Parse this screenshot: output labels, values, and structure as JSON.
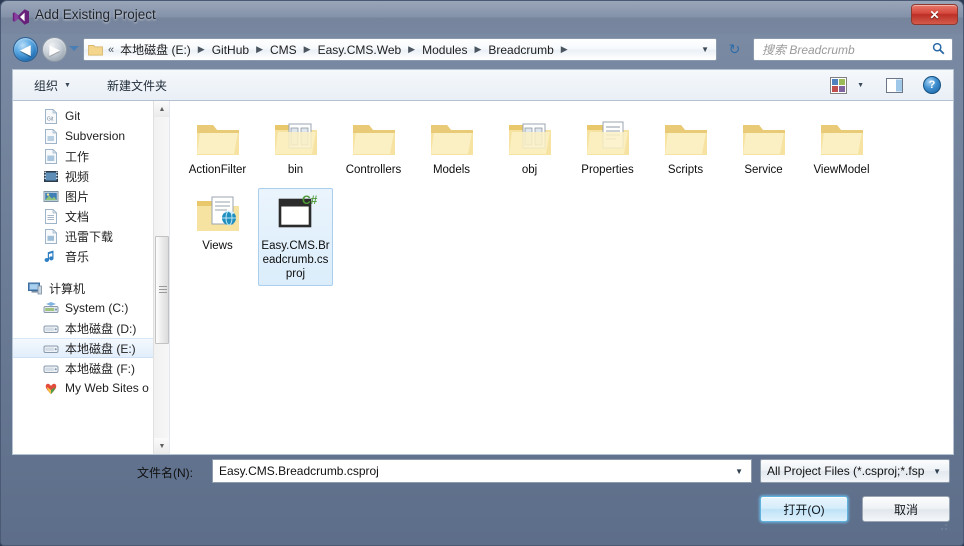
{
  "window": {
    "title": "Add Existing Project",
    "app_icon": "visual-studio-icon",
    "close_label": "✕",
    "accent_blue": "#2e6ca8",
    "close_red": "#d4453a"
  },
  "nav": {
    "back_label": "◀",
    "forward_label": "▶",
    "recent_label": "▾",
    "refresh_label": "↻",
    "breadcrumb_overflow": "«",
    "breadcrumb": [
      "本地磁盘 (E:)",
      "GitHub",
      "CMS",
      "Easy.CMS.Web",
      "Modules",
      "Breadcrumb"
    ],
    "breadcrumb_separator": "▶",
    "addr_dropdown_label": "▼"
  },
  "search": {
    "placeholder": "搜索 Breadcrumb",
    "icon": "search-icon",
    "icon_glyph": "🔍"
  },
  "toolbar": {
    "organize_label": "组织",
    "organize_caret": "▼",
    "new_folder_label": "新建文件夹",
    "viewmode_caret": "▼",
    "help_label": "?"
  },
  "sidebar": {
    "items": [
      {
        "label": "Git",
        "icon": "git-folder-icon",
        "type": "item",
        "selected": false
      },
      {
        "label": "Subversion",
        "icon": "subversion-folder-icon",
        "type": "item",
        "selected": false
      },
      {
        "label": "工作",
        "icon": "work-folder-icon",
        "type": "item",
        "selected": false
      },
      {
        "label": "视频",
        "icon": "videos-icon",
        "type": "item",
        "selected": false
      },
      {
        "label": "图片",
        "icon": "pictures-icon",
        "type": "item",
        "selected": false
      },
      {
        "label": "文档",
        "icon": "documents-icon",
        "type": "item",
        "selected": false
      },
      {
        "label": "迅雷下载",
        "icon": "downloads-icon",
        "type": "item",
        "selected": false
      },
      {
        "label": "音乐",
        "icon": "music-icon",
        "type": "item",
        "selected": false
      },
      {
        "label": "计算机",
        "icon": "computer-icon",
        "type": "header",
        "selected": false
      },
      {
        "label": "System (C:)",
        "icon": "system-drive-icon",
        "type": "item",
        "selected": false
      },
      {
        "label": "本地磁盘 (D:)",
        "icon": "drive-icon",
        "type": "item",
        "selected": false
      },
      {
        "label": "本地磁盘 (E:)",
        "icon": "drive-icon",
        "type": "item",
        "selected": true
      },
      {
        "label": "本地磁盘 (F:)",
        "icon": "drive-icon",
        "type": "item",
        "selected": false
      },
      {
        "label": "My Web Sites o",
        "icon": "my-web-sites-icon",
        "type": "item",
        "selected": false
      }
    ],
    "scroll_up": "▲",
    "scroll_down": "▼"
  },
  "files": {
    "items": [
      {
        "name": "ActionFilter",
        "kind": "folder",
        "selected": false
      },
      {
        "name": "bin",
        "kind": "folder-binary",
        "selected": false
      },
      {
        "name": "Controllers",
        "kind": "folder",
        "selected": false
      },
      {
        "name": "Models",
        "kind": "folder",
        "selected": false
      },
      {
        "name": "obj",
        "kind": "folder-binary",
        "selected": false
      },
      {
        "name": "Properties",
        "kind": "folder-doc",
        "selected": false
      },
      {
        "name": "Scripts",
        "kind": "folder",
        "selected": false
      },
      {
        "name": "Service",
        "kind": "folder",
        "selected": false
      },
      {
        "name": "ViewModel",
        "kind": "folder",
        "selected": false
      },
      {
        "name": "Views",
        "kind": "folder-web",
        "selected": false
      },
      {
        "name": "Easy.CMS.Breadcrumb.csproj",
        "kind": "csproj",
        "selected": true
      }
    ]
  },
  "bottom": {
    "filename_label": "文件名(N):",
    "filename_value": "Easy.CMS.Breadcrumb.csproj",
    "filename_caret": "▼",
    "filter_value": "All Project Files (*.csproj;*.fsp",
    "filter_caret": "▼",
    "open_label": "打开(O)",
    "cancel_label": "取消"
  }
}
